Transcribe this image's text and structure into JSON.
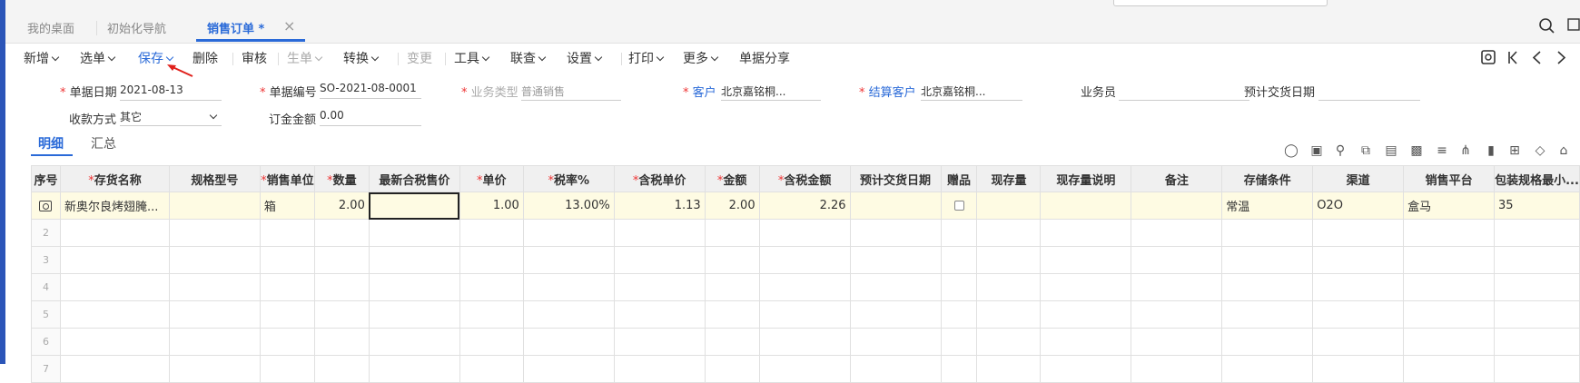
{
  "tabs": {
    "items": [
      {
        "label": "我的桌面"
      },
      {
        "label": "初始化导航"
      },
      {
        "label": "销售订单 *"
      }
    ]
  },
  "toolbar": {
    "items": [
      {
        "label": "新增"
      },
      {
        "label": "选单"
      },
      {
        "label": "保存"
      },
      {
        "label": "删除"
      },
      {
        "label": "审核"
      },
      {
        "label": "生单"
      },
      {
        "label": "转换"
      },
      {
        "label": "变更"
      },
      {
        "label": "工具"
      },
      {
        "label": "联查"
      },
      {
        "label": "设置"
      },
      {
        "label": "打印"
      },
      {
        "label": "更多"
      },
      {
        "label": "单据分享"
      }
    ]
  },
  "form": {
    "doc_date_label": "单据日期",
    "doc_date": "2021-08-13",
    "doc_no_label": "单据编号",
    "doc_no": "SO-2021-08-0001",
    "biz_type_label": "业务类型",
    "biz_type": "普通销售",
    "customer_label": "客户",
    "customer": "北京嘉铭桐...",
    "settle_customer_label": "结算客户",
    "settle_customer": "北京嘉铭桐...",
    "salesman_label": "业务员",
    "salesman": "",
    "delivery_date_label": "预计交货日期",
    "delivery_date": "",
    "payment_label": "收款方式",
    "payment": "其它",
    "deposit_label": "订金金额",
    "deposit": "0.00"
  },
  "subtabs": {
    "detail": "明细",
    "summary": "汇总"
  },
  "table": {
    "headers": [
      {
        "label": "序号",
        "req": false
      },
      {
        "label": "存货名称",
        "req": true
      },
      {
        "label": "规格型号",
        "req": false
      },
      {
        "label": "销售单位",
        "req": true
      },
      {
        "label": "数量",
        "req": true
      },
      {
        "label": "最新合税售价",
        "req": false
      },
      {
        "label": "单价",
        "req": true
      },
      {
        "label": "税率%",
        "req": true
      },
      {
        "label": "含税单价",
        "req": true
      },
      {
        "label": "金额",
        "req": true
      },
      {
        "label": "含税金额",
        "req": true
      },
      {
        "label": "预计交货日期",
        "req": false
      },
      {
        "label": "赠品",
        "req": false
      },
      {
        "label": "现存量",
        "req": false
      },
      {
        "label": "现存量说明",
        "req": false
      },
      {
        "label": "备注",
        "req": false
      },
      {
        "label": "存储条件",
        "req": false
      },
      {
        "label": "渠道",
        "req": false
      },
      {
        "label": "销售平台",
        "req": false
      },
      {
        "label": "包装规格最小...",
        "req": false
      }
    ],
    "row1": {
      "name": "新奥尔良烤翅腌...",
      "spec": "",
      "unit": "箱",
      "qty": "2.00",
      "latest_price": "",
      "price": "1.00",
      "tax_rate": "13.00%",
      "tax_price": "1.13",
      "amount": "2.00",
      "tax_amount": "2.26",
      "delivery": "",
      "stock": "",
      "stock_note": "",
      "remark": "",
      "storage": "常温",
      "channel": "O2O",
      "platform": "盒马",
      "pack": "35"
    },
    "row_numbers": [
      "2",
      "3",
      "4",
      "5",
      "6",
      "7"
    ]
  }
}
